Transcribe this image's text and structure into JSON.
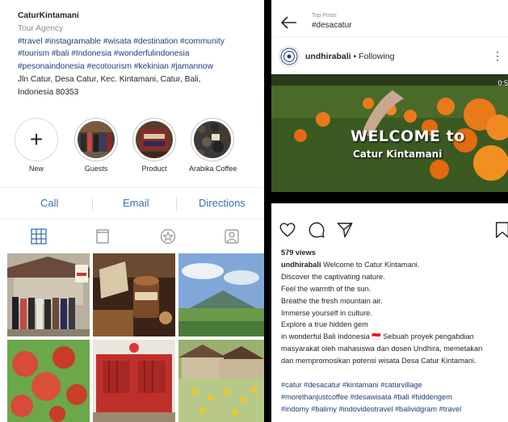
{
  "profile": {
    "name": "CaturKintamani",
    "category": "Tour Agency",
    "hashtags_line1": "#travel #instagramable #wisata #destination #community",
    "hashtags_line2": "#tourism #bali #Indonesia #wonderfulindonesia",
    "hashtags_line3": "#pesonaindonesia #ecotourism #kekinian #jamannow",
    "address_line1": "Jln Catur, Desa Catur, Kec. Kintamani, Catur, Bali,",
    "address_line2": "Indonesia 80353"
  },
  "highlights": [
    {
      "label": "New",
      "icon": "plus-icon"
    },
    {
      "label": "Guests"
    },
    {
      "label": "Product"
    },
    {
      "label": "Arabika Coffee"
    }
  ],
  "actions": {
    "call": "Call",
    "email": "Email",
    "directions": "Directions"
  },
  "tabs": [
    {
      "icon": "grid-icon"
    },
    {
      "icon": "igtv-icon"
    },
    {
      "icon": "guides-icon"
    },
    {
      "icon": "tagged-icon"
    }
  ],
  "post": {
    "topbar_small": "Top Posts",
    "topbar_tag": "#desacatur",
    "username": "undhirabali",
    "follow_state": "Following",
    "separator": "•",
    "video_time": "0:5",
    "overlay_title": "WELCOME to",
    "overlay_sub": "Catur Kintamani",
    "views": "579 views",
    "caption_user": "undhirabali",
    "caption_lines": [
      "Welcome to Catur Kintamani.",
      "Discover the captivating nature.",
      "Feel the warmth of the sun.",
      "Breathe the fresh mountain air.",
      "Immerse yourself in culture.",
      "Explore a true hidden gem",
      "in wonderful Bali Indonesia 🇮🇩 Sebuah proyek pengabdian",
      "masyarakat oleh mahasiswa dan dosen Undhira, memetakan",
      "dan mempromosikan potensi wisata Desa Catur Kintamani."
    ],
    "caption_tags": [
      "#catur #desacatur #kintamani #caturvillage",
      "#morethanjustcoffee #desawisata #bali #hiddengem",
      "#indomy #balimy #indovideotravel #balividgram #travel"
    ]
  },
  "colors": {
    "link_blue": "#3b6fb5",
    "hashtag": "#1f3d7a",
    "muted": "#8e8e8e"
  }
}
